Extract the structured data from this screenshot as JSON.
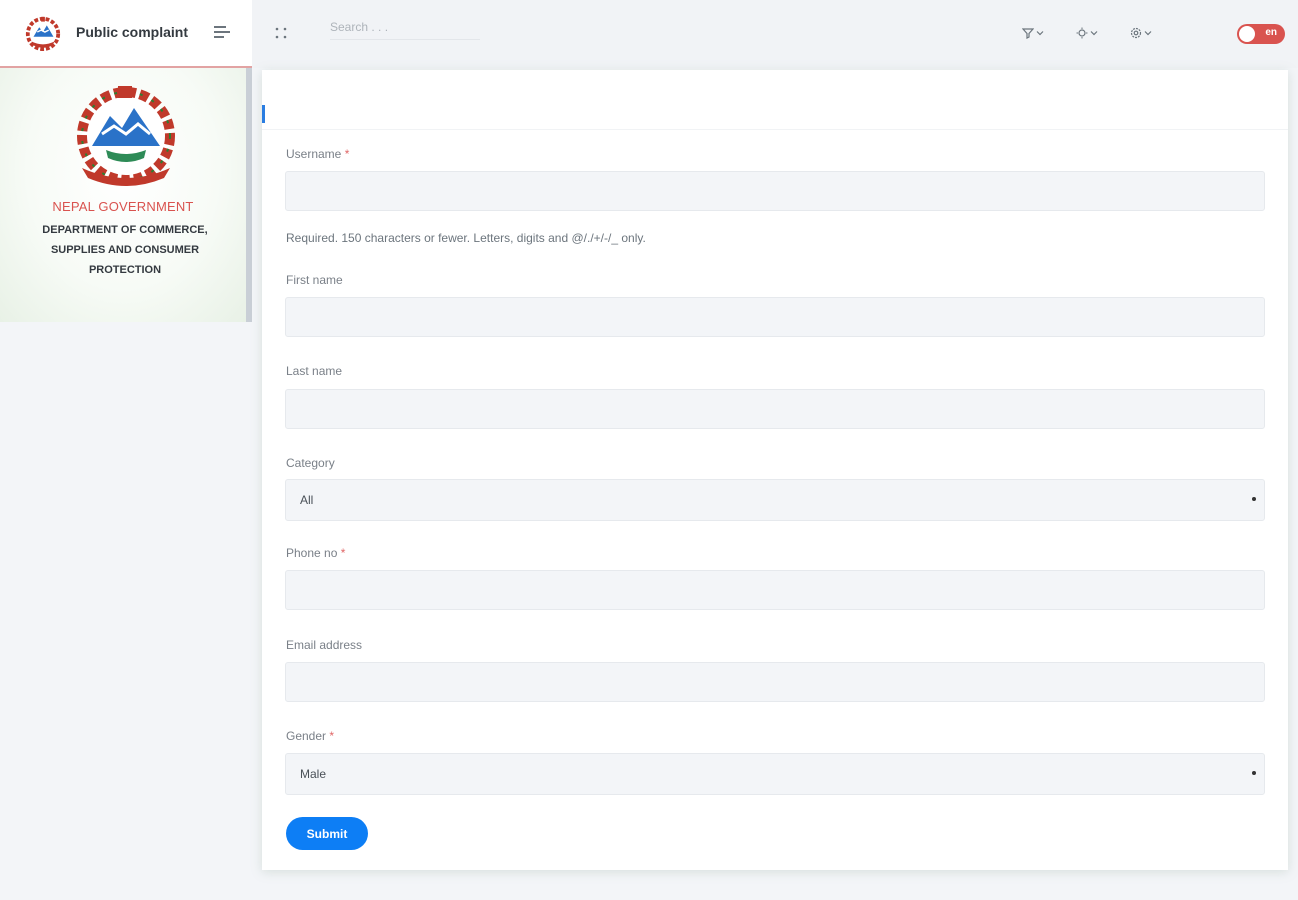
{
  "brand": {
    "title": "Public complaint"
  },
  "profile": {
    "gov_title": "NEPAL GOVERNMENT",
    "dept_title": "DEPARTMENT OF COMMERCE, SUPPLIES AND CONSUMER PROTECTION"
  },
  "topbar": {
    "search_placeholder": "Search . . .",
    "icons": [
      "fullscreen-icon",
      "filter-icon",
      "sun-icon",
      "settings-icon"
    ],
    "language": {
      "label": "en",
      "accent": "#d9534f"
    }
  },
  "form": {
    "username": {
      "label": "Username",
      "required": "*",
      "value": "",
      "help": "Required. 150 characters or fewer. Letters, digits and @/./+/-/_ only."
    },
    "first_name": {
      "label": "First name",
      "value": ""
    },
    "last_name": {
      "label": "Last name",
      "value": ""
    },
    "category": {
      "label": "Category",
      "selected": "All"
    },
    "phone": {
      "label": "Phone no",
      "required": "*",
      "value": ""
    },
    "email": {
      "label": "Email address",
      "value": ""
    },
    "gender": {
      "label": "Gender",
      "required": "*",
      "selected": "Male"
    },
    "submit_label": "Submit"
  },
  "colors": {
    "primary": "#0d7ef5",
    "danger": "#d9534f",
    "field_bg": "#f3f5f8"
  }
}
